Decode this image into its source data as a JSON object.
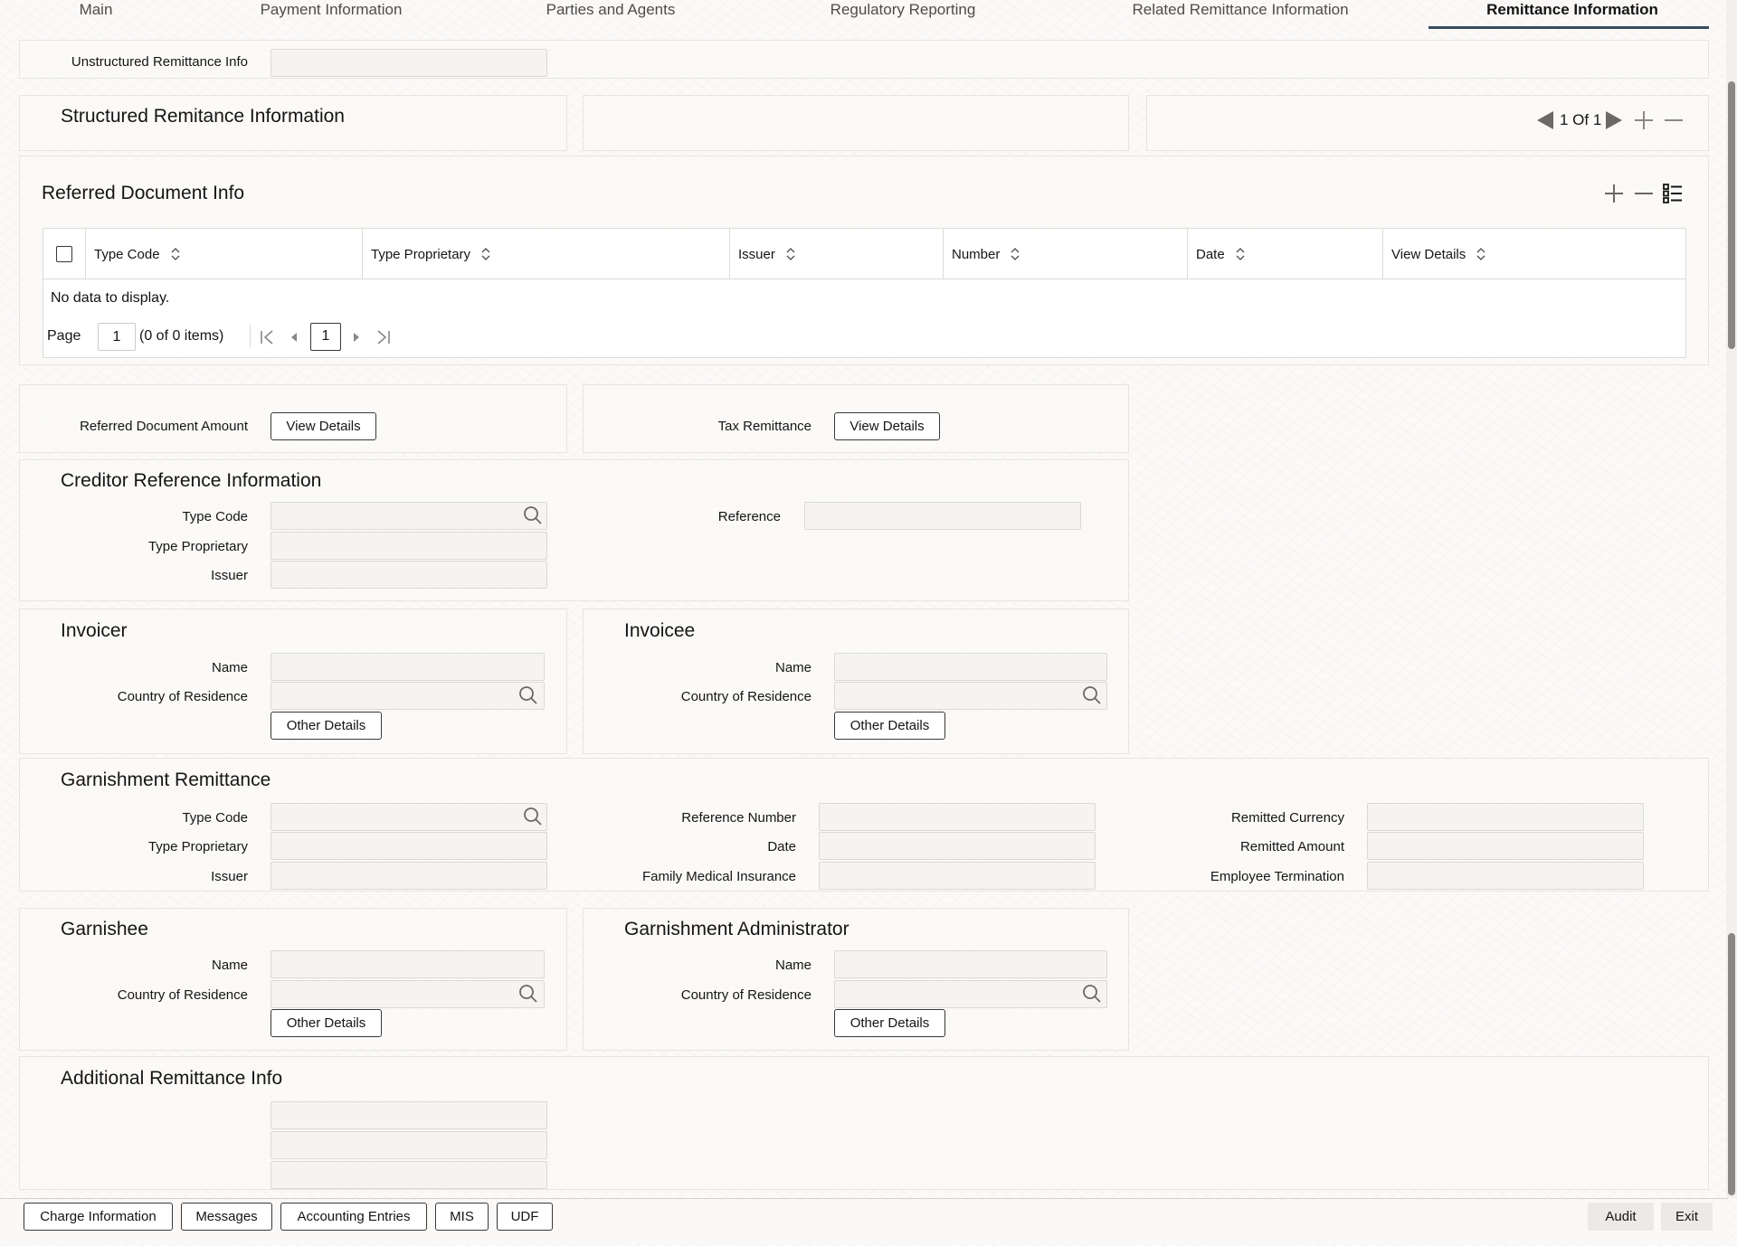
{
  "tabs": [
    {
      "label": "Main",
      "active": false
    },
    {
      "label": "Payment Information",
      "active": false
    },
    {
      "label": "Parties and Agents",
      "active": false
    },
    {
      "label": "Regulatory Reporting",
      "active": false
    },
    {
      "label": "Related Remittance Information",
      "active": false
    },
    {
      "label": "Remittance Information",
      "active": true
    }
  ],
  "unstructured": {
    "label": "Unstructured Remittance Info",
    "value": ""
  },
  "structured": {
    "title": "Structured Remitance Information",
    "pager_text": "1 Of 1"
  },
  "referred_doc": {
    "title": "Referred Document Info",
    "columns": [
      "Type Code",
      "Type Proprietary",
      "Issuer",
      "Number",
      "Date",
      "View Details"
    ],
    "empty_text": "No data to display.",
    "page_label": "Page",
    "page_value": "1",
    "items_text": "(0 of 0 items)",
    "current_page": "1"
  },
  "amounts": {
    "referred_label": "Referred Document Amount",
    "tax_label": "Tax Remittance",
    "view_details": "View Details"
  },
  "creditor": {
    "title": "Creditor Reference Information",
    "type_code": "Type Code",
    "type_proprietary": "Type Proprietary",
    "issuer": "Issuer",
    "reference": "Reference"
  },
  "invoicer": {
    "title": "Invoicer",
    "name": "Name",
    "country": "Country of Residence",
    "other": "Other Details"
  },
  "invoicee": {
    "title": "Invoicee",
    "name": "Name",
    "country": "Country of Residence",
    "other": "Other Details"
  },
  "garnishment": {
    "title": "Garnishment Remittance",
    "type_code": "Type Code",
    "type_proprietary": "Type Proprietary",
    "issuer": "Issuer",
    "reference_number": "Reference Number",
    "date": "Date",
    "family_medical": "Family Medical Insurance",
    "remitted_currency": "Remitted Currency",
    "remitted_amount": "Remitted Amount",
    "employee_termination": "Employee Termination"
  },
  "garnishee": {
    "title": "Garnishee",
    "name": "Name",
    "country": "Country of Residence",
    "other": "Other Details"
  },
  "garnishment_admin": {
    "title": "Garnishment Administrator",
    "name": "Name",
    "country": "Country of Residence",
    "other": "Other Details"
  },
  "additional": {
    "title": "Additional Remittance Info"
  },
  "footer": {
    "left_buttons": [
      "Charge Information",
      "Messages",
      "Accounting Entries",
      "MIS",
      "UDF"
    ],
    "audit": "Audit",
    "exit": "Exit"
  },
  "colors": {
    "accent": "#3a4a5c",
    "text": "#161513",
    "border": "#3b3835"
  },
  "icons": [
    "search-icon",
    "sort-icon",
    "previous-arrow-icon",
    "next-arrow-icon",
    "add-icon",
    "remove-icon",
    "list-view-icon",
    "first-page-icon",
    "previous-page-icon",
    "next-page-icon",
    "last-page-icon"
  ]
}
